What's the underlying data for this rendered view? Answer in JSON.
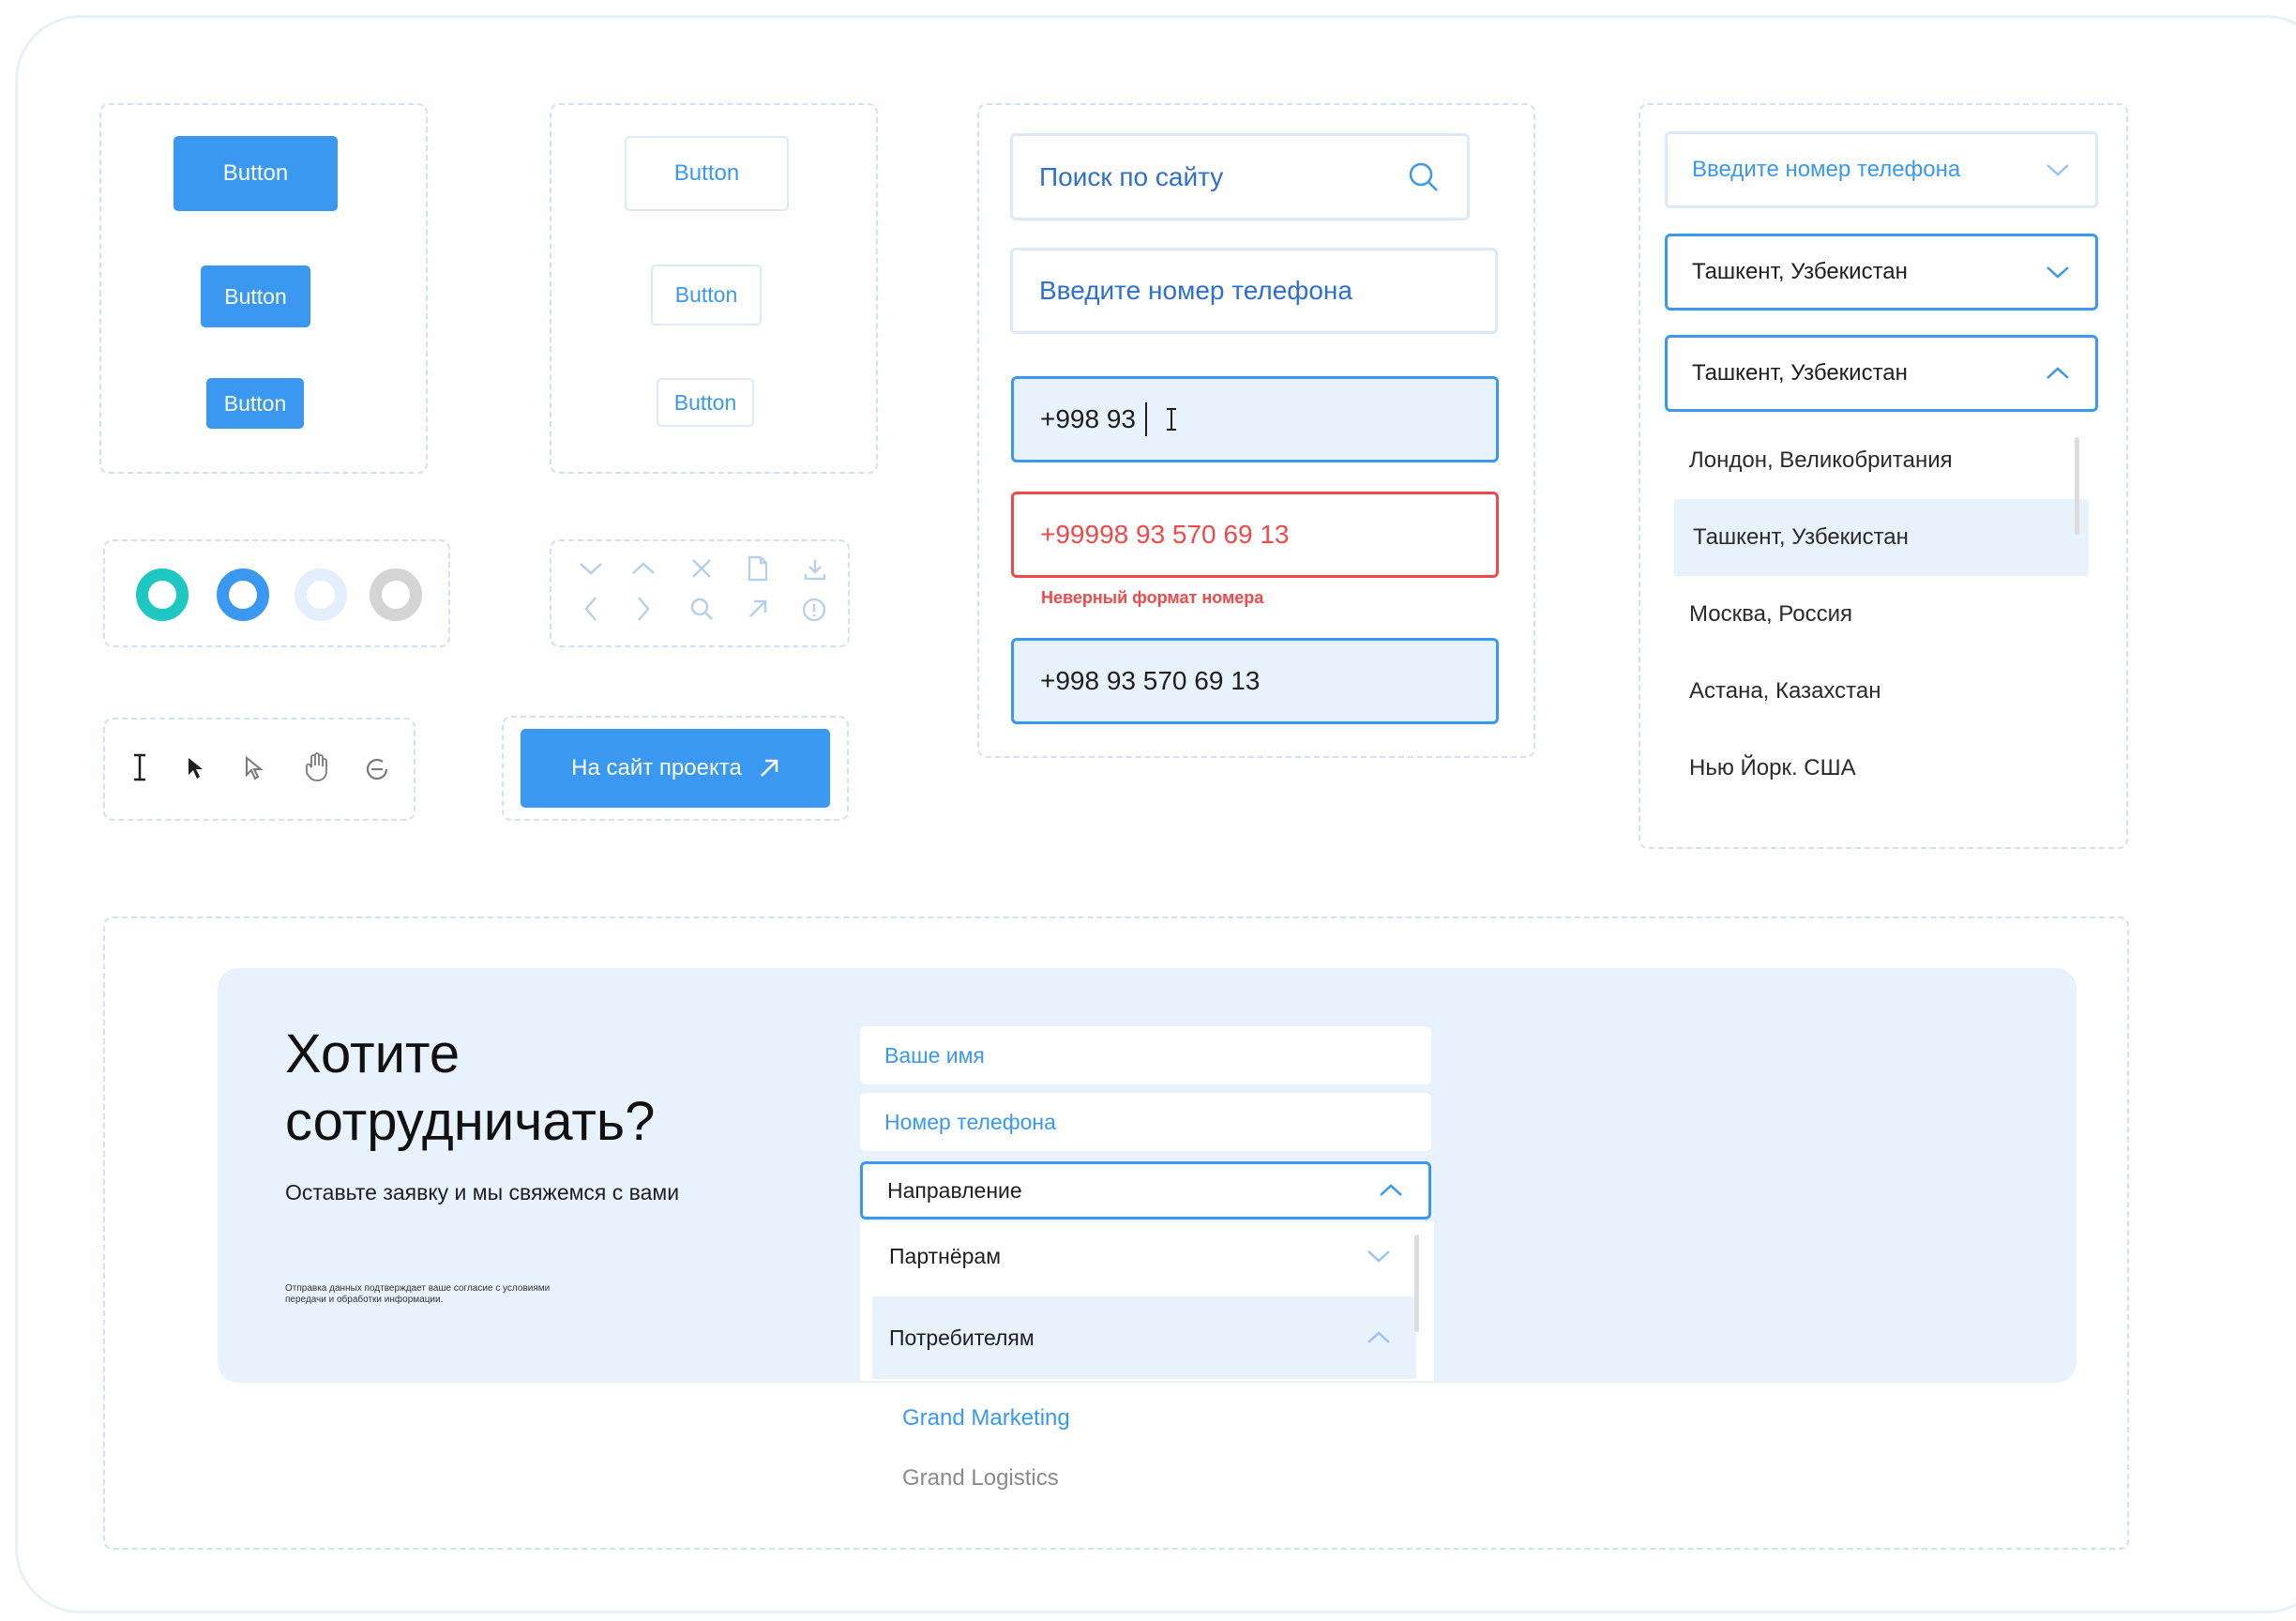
{
  "buttons": {
    "primary_large": "Button",
    "primary_medium": "Button",
    "primary_small": "Button",
    "outline_large": "Button",
    "outline_medium": "Button",
    "outline_small": "Button",
    "project": "На сайт проекта"
  },
  "radios": [
    {
      "name": "teal",
      "color": "#1ec8c0"
    },
    {
      "name": "blue",
      "color": "#3a98f0"
    },
    {
      "name": "light",
      "color": "#e3efff"
    },
    {
      "name": "gray",
      "color": "#d4d4d4"
    }
  ],
  "inputs": {
    "search_placeholder": "Поиск по сайту",
    "phone_placeholder": "Введите номер телефона",
    "phone_typing": "+998 93",
    "phone_error_value": "+99998 93 570 69 13",
    "phone_error_message": "Неверный формат номера",
    "phone_filled": "+998 93 570 69 13"
  },
  "dropdowns": {
    "phone_select_placeholder": "Введите номер телефона",
    "city_closed": "Ташкент, Узбекистан",
    "city_open": "Ташкент, Узбекистан",
    "city_options": [
      "Лондон, Великобритания",
      "Ташкент, Узбекистан",
      "Москва, Россия",
      "Астана, Казахстан",
      "Нью Йорк. США"
    ],
    "city_selected_index": 1
  },
  "form": {
    "title_line1": "Хотите",
    "title_line2": "сотрудничать?",
    "subtitle": "Оставьте заявку и мы свяжемся с вами",
    "disclaimer_line1": "Отправка данных подтверждает ваше согласие с условиями",
    "disclaimer_line2": "передачи и обработки информации.",
    "name_placeholder": "Ваше имя",
    "phone_placeholder": "Номер телефона",
    "direction_label": "Направление",
    "options": [
      "Партнёрам",
      "Потребителям"
    ],
    "sub_options": [
      "Grand Marketing",
      "Grand Logistics"
    ]
  },
  "colors": {
    "accent": "#3a98f0",
    "error": "#ef4a4a",
    "light_bg": "#e8f2fd"
  }
}
